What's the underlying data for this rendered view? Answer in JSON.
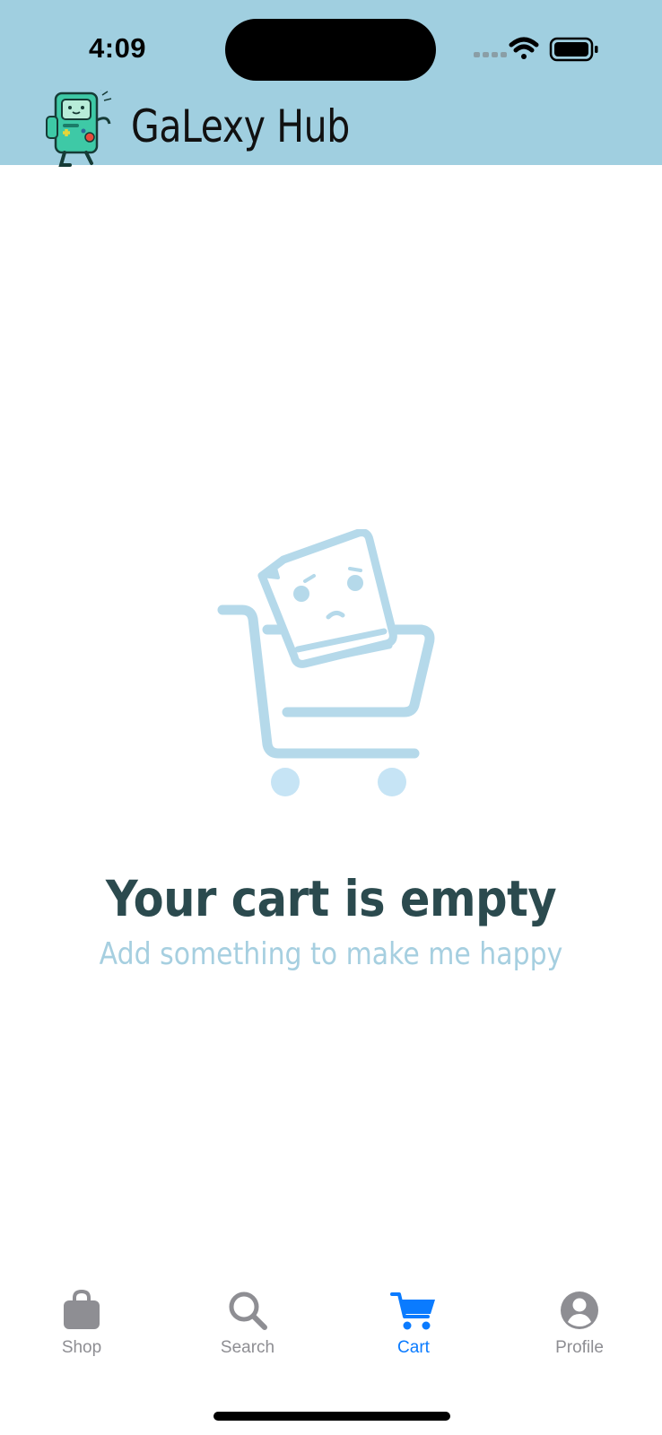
{
  "status_bar": {
    "time": "4:09"
  },
  "header": {
    "app_title": "GaLexy Hub",
    "logo_icon": "robot-mascot-icon"
  },
  "empty_state": {
    "title": "Your cart is empty",
    "subtitle": "Add something to make me happy",
    "illustration_icon": "sad-receipt-cart-icon"
  },
  "tabbar": {
    "active": "Cart",
    "accent_color": "#0a7bff",
    "inactive_color": "#8e8e93",
    "tabs": [
      {
        "label": "Shop",
        "icon": "shopping-bag-icon"
      },
      {
        "label": "Search",
        "icon": "magnifier-icon"
      },
      {
        "label": "Cart",
        "icon": "cart-icon"
      },
      {
        "label": "Profile",
        "icon": "person-circle-icon"
      }
    ]
  },
  "colors": {
    "header_bg": "#a0cfe0",
    "title": "#2b4a4e",
    "subtitle": "#a6cfe0"
  }
}
